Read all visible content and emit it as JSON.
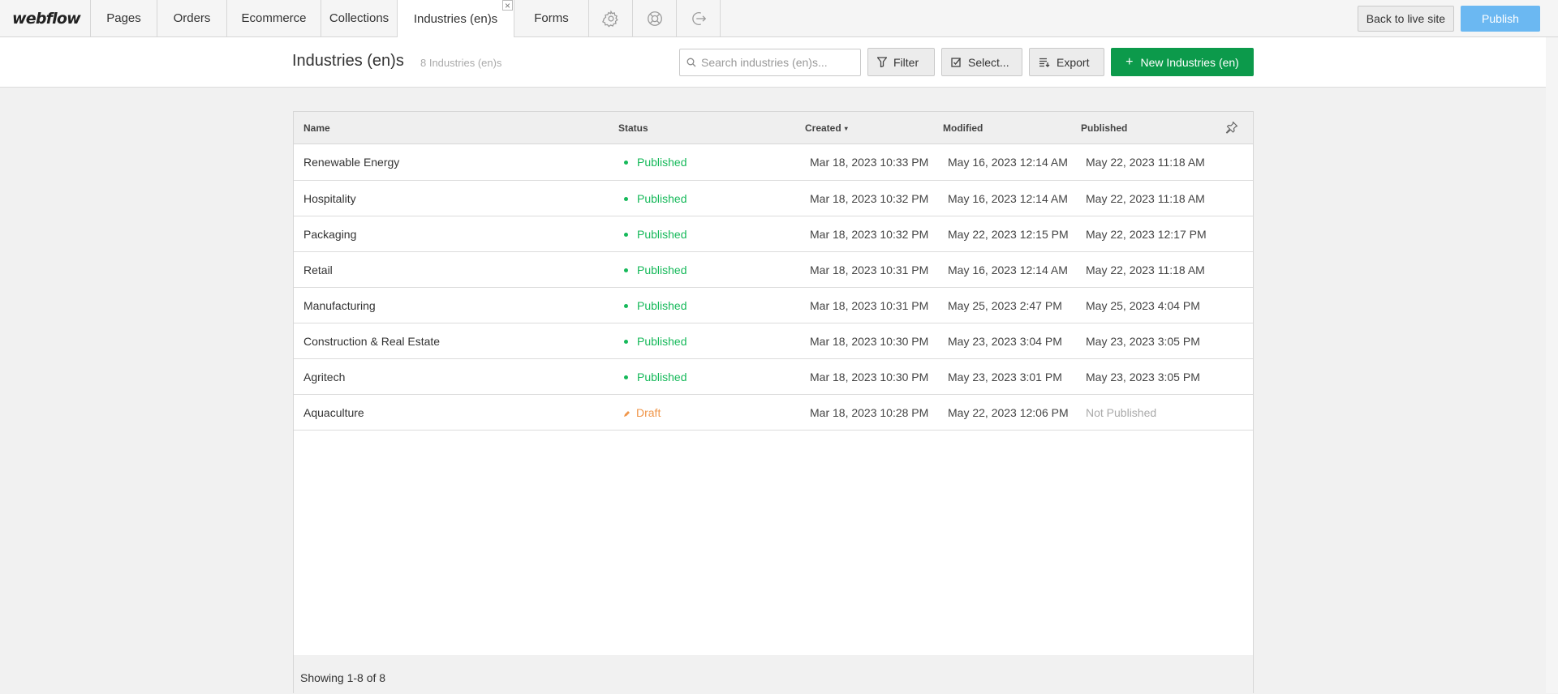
{
  "nav": {
    "logo": "webflow",
    "tabs": [
      "Pages",
      "Orders",
      "Ecommerce",
      "Collections",
      "Industries (en)s",
      "Forms"
    ],
    "close_glyph": "×",
    "icons": [
      "gear-icon",
      "help-icon",
      "logout-icon"
    ],
    "back_label": "Back to live site",
    "publish_label": "Publish"
  },
  "header": {
    "title": "Industries (en)s",
    "count": "8 Industries (en)s",
    "search_placeholder": "Search industries (en)s...",
    "filter_label": "Filter",
    "select_label": "Select...",
    "export_label": "Export",
    "new_label": "New Industries (en)",
    "new_icon": "+"
  },
  "table": {
    "columns": [
      "Name",
      "Status",
      "Created",
      "Modified",
      "Published"
    ],
    "sort_indicator": "▾",
    "rows": [
      {
        "name": "Renewable Energy",
        "status": "Published",
        "created": "Mar 18, 2023 10:33 PM",
        "modified": "May 16, 2023 12:14 AM",
        "published": "May 22, 2023 11:18 AM"
      },
      {
        "name": "Hospitality",
        "status": "Published",
        "created": "Mar 18, 2023 10:32 PM",
        "modified": "May 16, 2023 12:14 AM",
        "published": "May 22, 2023 11:18 AM"
      },
      {
        "name": "Packaging",
        "status": "Published",
        "created": "Mar 18, 2023 10:32 PM",
        "modified": "May 22, 2023 12:15 PM",
        "published": "May 22, 2023 12:17 PM"
      },
      {
        "name": "Retail",
        "status": "Published",
        "created": "Mar 18, 2023 10:31 PM",
        "modified": "May 16, 2023 12:14 AM",
        "published": "May 22, 2023 11:18 AM"
      },
      {
        "name": "Manufacturing",
        "status": "Published",
        "created": "Mar 18, 2023 10:31 PM",
        "modified": "May 25, 2023 2:47 PM",
        "published": "May 25, 2023 4:04 PM"
      },
      {
        "name": "Construction & Real Estate",
        "status": "Published",
        "created": "Mar 18, 2023 10:30 PM",
        "modified": "May 23, 2023 3:04 PM",
        "published": "May 23, 2023 3:05 PM"
      },
      {
        "name": "Agritech",
        "status": "Published",
        "created": "Mar 18, 2023 10:30 PM",
        "modified": "May 23, 2023 3:01 PM",
        "published": "May 23, 2023 3:05 PM"
      },
      {
        "name": "Aquaculture",
        "status": "Draft",
        "created": "Mar 18, 2023 10:28 PM",
        "modified": "May 22, 2023 12:06 PM",
        "published": "Not Published"
      }
    ],
    "footer": "Showing 1-8 of 8"
  },
  "colors": {
    "published": "#16b95a",
    "draft": "#f0964a",
    "new_button": "#0c9a4b",
    "publish_button": "#6bb8f2"
  }
}
